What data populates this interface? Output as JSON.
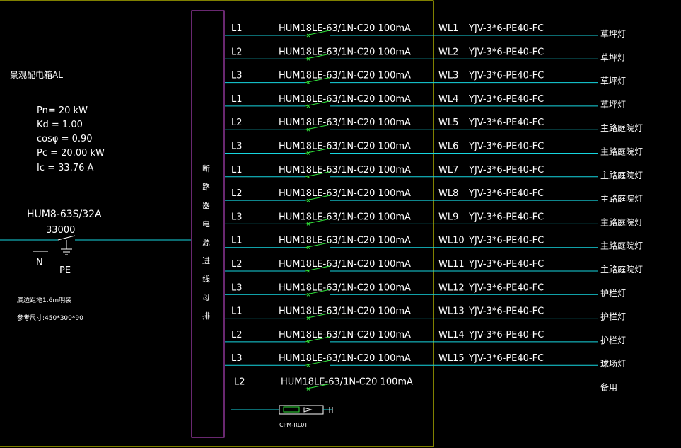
{
  "panel": {
    "title": "景观配电箱AL",
    "params": [
      "Pn= 20  kW",
      "Kd = 1.00",
      "cosφ = 0.90",
      "Pc = 20.00  kW",
      "Ic = 33.76  A"
    ],
    "main_breaker": "HUM8-63S/32A",
    "main_breaker_code": "33000",
    "n_label": "N",
    "pe_label": "PE",
    "install_note": "底边距地1.6m明装",
    "size_note": "参考尺寸:450*300*90",
    "bus_text": [
      "断",
      "路",
      "器",
      "电",
      "源",
      "进",
      "线",
      "母",
      "排"
    ],
    "meter_label": "CPM-RL0T"
  },
  "circuits": [
    {
      "phase": "L1",
      "breaker": "HUM18LE-63/1N-C20  100mA",
      "wl": "WL1",
      "cable": "YJV-3*6-PE40-FC",
      "load": "草坪灯"
    },
    {
      "phase": "L2",
      "breaker": "HUM18LE-63/1N-C20  100mA",
      "wl": "WL2",
      "cable": "YJV-3*6-PE40-FC",
      "load": "草坪灯"
    },
    {
      "phase": "L3",
      "breaker": "HUM18LE-63/1N-C20  100mA",
      "wl": "WL3",
      "cable": "YJV-3*6-PE40-FC",
      "load": "草坪灯"
    },
    {
      "phase": "L1",
      "breaker": "HUM18LE-63/1N-C20  100mA",
      "wl": "WL4",
      "cable": "YJV-3*6-PE40-FC",
      "load": "草坪灯"
    },
    {
      "phase": "L2",
      "breaker": "HUM18LE-63/1N-C20  100mA",
      "wl": "WL5",
      "cable": "YJV-3*6-PE40-FC",
      "load": "主路庭院灯"
    },
    {
      "phase": "L3",
      "breaker": "HUM18LE-63/1N-C20  100mA",
      "wl": "WL6",
      "cable": "YJV-3*6-PE40-FC",
      "load": "主路庭院灯"
    },
    {
      "phase": "L1",
      "breaker": "HUM18LE-63/1N-C20  100mA",
      "wl": "WL7",
      "cable": "YJV-3*6-PE40-FC",
      "load": "主路庭院灯"
    },
    {
      "phase": "L2",
      "breaker": "HUM18LE-63/1N-C20  100mA",
      "wl": "WL8",
      "cable": "YJV-3*6-PE40-FC",
      "load": "主路庭院灯"
    },
    {
      "phase": "L3",
      "breaker": "HUM18LE-63/1N-C20  100mA",
      "wl": "WL9",
      "cable": "YJV-3*6-PE40-FC",
      "load": "主路庭院灯"
    },
    {
      "phase": "L1",
      "breaker": "HUM18LE-63/1N-C20  100mA",
      "wl": "WL10",
      "cable": "YJV-3*6-PE40-FC",
      "load": "主路庭院灯"
    },
    {
      "phase": "L2",
      "breaker": "HUM18LE-63/1N-C20  100mA",
      "wl": "WL11",
      "cable": "YJV-3*6-PE40-FC",
      "load": "主路庭院灯"
    },
    {
      "phase": "L3",
      "breaker": "HUM18LE-63/1N-C20  100mA",
      "wl": "WL12",
      "cable": "YJV-3*6-PE40-FC",
      "load": "护栏灯"
    },
    {
      "phase": "L1",
      "breaker": "HUM18LE-63/1N-C20  100mA",
      "wl": "WL13",
      "cable": "YJV-3*6-PE40-FC",
      "load": "护栏灯"
    },
    {
      "phase": "L2",
      "breaker": "HUM18LE-63/1N-C20  100mA",
      "wl": "WL14",
      "cable": "YJV-3*6-PE40-FC",
      "load": "护栏灯"
    },
    {
      "phase": "L3",
      "breaker": "HUM18LE-63/1N-C20  100mA",
      "wl": "WL15",
      "cable": "YJV-3*6-PE40-FC",
      "load": "球场灯"
    },
    {
      "phase": "L2",
      "breaker": "HUM18LE-63/1N-C20  100mA",
      "wl": "",
      "cable": "",
      "load": "备用"
    }
  ],
  "colors": {
    "wire": "#16d6e0",
    "frame": "#ffff00",
    "bus": "#d24fe0",
    "switch": "#2fe03a",
    "text": "#ffffff",
    "background": "#000000"
  }
}
